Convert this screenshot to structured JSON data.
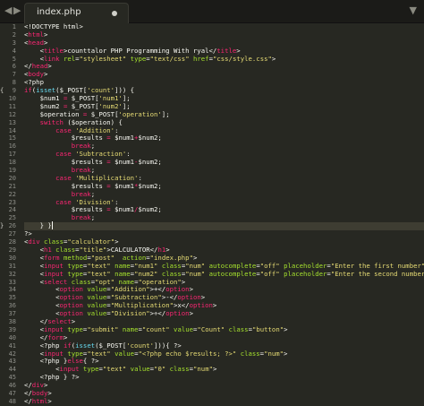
{
  "tab": {
    "filename": "index.php"
  },
  "icons": {
    "back": "chevron-left-icon",
    "forward": "chevron-right-icon",
    "menu": "chevron-down-icon"
  },
  "colors": {
    "background": "#272822",
    "keyword": "#f92672",
    "attribute": "#a6e22e",
    "string": "#e6db74",
    "plain": "#f8f8f2"
  },
  "lines": [
    {
      "n": "1",
      "tokens": [
        [
          "v",
          "<!DOCTYPE html>"
        ]
      ]
    },
    {
      "n": "2",
      "tokens": [
        [
          "v",
          "<"
        ],
        [
          "t",
          "html"
        ],
        [
          "v",
          ">"
        ]
      ]
    },
    {
      "n": "3",
      "tokens": [
        [
          "v",
          "<"
        ],
        [
          "t",
          "head"
        ],
        [
          "v",
          ">"
        ]
      ]
    },
    {
      "n": "4",
      "tokens": [
        [
          "v",
          "    <"
        ],
        [
          "t",
          "title"
        ],
        [
          "v",
          ">counttalor PHP Programming With ryal</"
        ],
        [
          "t",
          "title"
        ],
        [
          "v",
          ">"
        ]
      ]
    },
    {
      "n": "5",
      "tokens": [
        [
          "v",
          "    <"
        ],
        [
          "t",
          "link"
        ],
        [
          "v",
          " "
        ],
        [
          "a",
          "rel"
        ],
        [
          "v",
          "="
        ],
        [
          "s",
          "\"stylesheet\""
        ],
        [
          "v",
          " "
        ],
        [
          "a",
          "type"
        ],
        [
          "v",
          "="
        ],
        [
          "s",
          "\"text/css\""
        ],
        [
          "v",
          " "
        ],
        [
          "a",
          "href"
        ],
        [
          "v",
          "="
        ],
        [
          "s",
          "\"css/style.css\""
        ],
        [
          "v",
          ">"
        ]
      ]
    },
    {
      "n": "6",
      "tokens": [
        [
          "v",
          "</"
        ],
        [
          "t",
          "head"
        ],
        [
          "v",
          ">"
        ]
      ]
    },
    {
      "n": "7",
      "tokens": [
        [
          "v",
          "<"
        ],
        [
          "t",
          "body"
        ],
        [
          "v",
          ">"
        ]
      ]
    },
    {
      "n": "8",
      "tokens": [
        [
          "v",
          "<?php"
        ]
      ]
    },
    {
      "n": "9",
      "fold": "{",
      "tokens": [
        [
          "t",
          "if"
        ],
        [
          "v",
          "("
        ],
        [
          "f",
          "isset"
        ],
        [
          "v",
          "($_POST["
        ],
        [
          "s",
          "'count'"
        ],
        [
          "v",
          "])) {"
        ]
      ]
    },
    {
      "n": "10",
      "tokens": [
        [
          "v",
          "    $num1 "
        ],
        [
          "t",
          "="
        ],
        [
          "v",
          " $_POST["
        ],
        [
          "s",
          "'num1'"
        ],
        [
          "v",
          "];"
        ]
      ]
    },
    {
      "n": "11",
      "tokens": [
        [
          "v",
          "    $num2 "
        ],
        [
          "t",
          "="
        ],
        [
          "v",
          " $_POST["
        ],
        [
          "s",
          "'num2'"
        ],
        [
          "v",
          "];"
        ]
      ]
    },
    {
      "n": "12",
      "tokens": [
        [
          "v",
          "    $operation "
        ],
        [
          "t",
          "="
        ],
        [
          "v",
          " $_POST["
        ],
        [
          "s",
          "'operation'"
        ],
        [
          "v",
          "];"
        ]
      ]
    },
    {
      "n": "13",
      "tokens": [
        [
          "v",
          "    "
        ],
        [
          "t",
          "switch"
        ],
        [
          "v",
          " ($operation) {"
        ]
      ]
    },
    {
      "n": "14",
      "tokens": [
        [
          "v",
          "        "
        ],
        [
          "t",
          "case"
        ],
        [
          "v",
          " "
        ],
        [
          "s",
          "'Addition'"
        ],
        [
          "v",
          ":"
        ]
      ]
    },
    {
      "n": "15",
      "tokens": [
        [
          "v",
          "            $results "
        ],
        [
          "t",
          "="
        ],
        [
          "v",
          " $num1"
        ],
        [
          "t",
          "+"
        ],
        [
          "v",
          "$num2;"
        ]
      ]
    },
    {
      "n": "16",
      "tokens": [
        [
          "v",
          "            "
        ],
        [
          "t",
          "break"
        ],
        [
          "v",
          ";"
        ]
      ]
    },
    {
      "n": "17",
      "tokens": [
        [
          "v",
          "        "
        ],
        [
          "t",
          "case"
        ],
        [
          "v",
          " "
        ],
        [
          "s",
          "'Subtraction'"
        ],
        [
          "v",
          ":"
        ]
      ]
    },
    {
      "n": "18",
      "tokens": [
        [
          "v",
          "            $results "
        ],
        [
          "t",
          "="
        ],
        [
          "v",
          " $num1"
        ],
        [
          "t",
          "-"
        ],
        [
          "v",
          "$num2;"
        ]
      ]
    },
    {
      "n": "19",
      "tokens": [
        [
          "v",
          "            "
        ],
        [
          "t",
          "break"
        ],
        [
          "v",
          ";"
        ]
      ]
    },
    {
      "n": "20",
      "tokens": [
        [
          "v",
          "        "
        ],
        [
          "t",
          "case"
        ],
        [
          "v",
          " "
        ],
        [
          "s",
          "'Multiplication'"
        ],
        [
          "v",
          ":"
        ]
      ]
    },
    {
      "n": "21",
      "tokens": [
        [
          "v",
          "            $results "
        ],
        [
          "t",
          "="
        ],
        [
          "v",
          " $num1"
        ],
        [
          "t",
          "*"
        ],
        [
          "v",
          "$num2;"
        ]
      ]
    },
    {
      "n": "22",
      "tokens": [
        [
          "v",
          "            "
        ],
        [
          "t",
          "break"
        ],
        [
          "v",
          ";"
        ]
      ]
    },
    {
      "n": "23",
      "tokens": [
        [
          "v",
          "        "
        ],
        [
          "t",
          "case"
        ],
        [
          "v",
          " "
        ],
        [
          "s",
          "'Division'"
        ],
        [
          "v",
          ":"
        ]
      ]
    },
    {
      "n": "24",
      "tokens": [
        [
          "v",
          "            $results "
        ],
        [
          "t",
          "="
        ],
        [
          "v",
          " $num1"
        ],
        [
          "t",
          "/"
        ],
        [
          "v",
          "$num2;"
        ]
      ]
    },
    {
      "n": "25",
      "tokens": [
        [
          "v",
          "            "
        ],
        [
          "t",
          "break"
        ],
        [
          "v",
          ";"
        ]
      ]
    },
    {
      "n": "26",
      "fold": "}",
      "current": true,
      "tokens": [
        [
          "v",
          "    } }"
        ]
      ]
    },
    {
      "n": "27",
      "tokens": [
        [
          "v",
          "?>"
        ]
      ]
    },
    {
      "n": "28",
      "tokens": [
        [
          "v",
          "<"
        ],
        [
          "t",
          "div"
        ],
        [
          "v",
          " "
        ],
        [
          "a",
          "class"
        ],
        [
          "v",
          "="
        ],
        [
          "s",
          "\"calculator\""
        ],
        [
          "v",
          ">"
        ]
      ]
    },
    {
      "n": "29",
      "tokens": [
        [
          "v",
          "    <"
        ],
        [
          "t",
          "h1"
        ],
        [
          "v",
          " "
        ],
        [
          "a",
          "class"
        ],
        [
          "v",
          "="
        ],
        [
          "s",
          "\"title\""
        ],
        [
          "v",
          ">CALCULATOR</"
        ],
        [
          "t",
          "h1"
        ],
        [
          "v",
          ">"
        ]
      ]
    },
    {
      "n": "30",
      "tokens": [
        [
          "v",
          "    <"
        ],
        [
          "t",
          "form"
        ],
        [
          "v",
          " "
        ],
        [
          "a",
          "method"
        ],
        [
          "v",
          "="
        ],
        [
          "s",
          "\"post\""
        ],
        [
          "v",
          "  "
        ],
        [
          "a",
          "action"
        ],
        [
          "v",
          "="
        ],
        [
          "s",
          "\"index.php\""
        ],
        [
          "v",
          ">"
        ]
      ]
    },
    {
      "n": "31",
      "tokens": [
        [
          "v",
          "    <"
        ],
        [
          "t",
          "input"
        ],
        [
          "v",
          " "
        ],
        [
          "a",
          "type"
        ],
        [
          "v",
          "="
        ],
        [
          "s",
          "\"text\""
        ],
        [
          "v",
          " "
        ],
        [
          "a",
          "name"
        ],
        [
          "v",
          "="
        ],
        [
          "s",
          "\"num1\""
        ],
        [
          "v",
          " "
        ],
        [
          "a",
          "class"
        ],
        [
          "v",
          "="
        ],
        [
          "s",
          "\"num\""
        ],
        [
          "v",
          " "
        ],
        [
          "a",
          "autocomplete"
        ],
        [
          "v",
          "="
        ],
        [
          "s",
          "\"off\""
        ],
        [
          "v",
          " "
        ],
        [
          "a",
          "placeholder"
        ],
        [
          "v",
          "="
        ],
        [
          "s",
          "\"Enter the first number\""
        ],
        [
          "v",
          ">"
        ]
      ]
    },
    {
      "n": "32",
      "tokens": [
        [
          "v",
          "    <"
        ],
        [
          "t",
          "input"
        ],
        [
          "v",
          " "
        ],
        [
          "a",
          "type"
        ],
        [
          "v",
          "="
        ],
        [
          "s",
          "\"text\""
        ],
        [
          "v",
          " "
        ],
        [
          "a",
          "name"
        ],
        [
          "v",
          "="
        ],
        [
          "s",
          "\"num2\""
        ],
        [
          "v",
          " "
        ],
        [
          "a",
          "class"
        ],
        [
          "v",
          "="
        ],
        [
          "s",
          "\"num\""
        ],
        [
          "v",
          " "
        ],
        [
          "a",
          "autocomplete"
        ],
        [
          "v",
          "="
        ],
        [
          "s",
          "\"off\""
        ],
        [
          "v",
          " "
        ],
        [
          "a",
          "placeholder"
        ],
        [
          "v",
          "="
        ],
        [
          "s",
          "\"Enter the second number\""
        ],
        [
          "v",
          ">"
        ]
      ]
    },
    {
      "n": "33",
      "tokens": [
        [
          "v",
          "    <"
        ],
        [
          "t",
          "select"
        ],
        [
          "v",
          " "
        ],
        [
          "a",
          "class"
        ],
        [
          "v",
          "="
        ],
        [
          "s",
          "\"opt\""
        ],
        [
          "v",
          " "
        ],
        [
          "a",
          "name"
        ],
        [
          "v",
          "="
        ],
        [
          "s",
          "\"operation\""
        ],
        [
          "v",
          ">"
        ]
      ]
    },
    {
      "n": "34",
      "tokens": [
        [
          "v",
          "        <"
        ],
        [
          "t",
          "option"
        ],
        [
          "v",
          " "
        ],
        [
          "a",
          "value"
        ],
        [
          "v",
          "="
        ],
        [
          "s",
          "\"Addition\""
        ],
        [
          "v",
          ">+</"
        ],
        [
          "t",
          "option"
        ],
        [
          "v",
          ">"
        ]
      ]
    },
    {
      "n": "35",
      "tokens": [
        [
          "v",
          "        <"
        ],
        [
          "t",
          "option"
        ],
        [
          "v",
          " "
        ],
        [
          "a",
          "value"
        ],
        [
          "v",
          "="
        ],
        [
          "s",
          "\"Subtraction\""
        ],
        [
          "v",
          ">-</"
        ],
        [
          "t",
          "option"
        ],
        [
          "v",
          ">"
        ]
      ]
    },
    {
      "n": "36",
      "tokens": [
        [
          "v",
          "        <"
        ],
        [
          "t",
          "option"
        ],
        [
          "v",
          " "
        ],
        [
          "a",
          "value"
        ],
        [
          "v",
          "="
        ],
        [
          "s",
          "\"Multiplication\""
        ],
        [
          "v",
          ">x</"
        ],
        [
          "t",
          "option"
        ],
        [
          "v",
          ">"
        ]
      ]
    },
    {
      "n": "37",
      "tokens": [
        [
          "v",
          "        <"
        ],
        [
          "t",
          "option"
        ],
        [
          "v",
          " "
        ],
        [
          "a",
          "value"
        ],
        [
          "v",
          "="
        ],
        [
          "s",
          "\"Division\""
        ],
        [
          "v",
          ">÷</"
        ],
        [
          "t",
          "option"
        ],
        [
          "v",
          ">"
        ]
      ]
    },
    {
      "n": "38",
      "tokens": [
        [
          "v",
          "    </"
        ],
        [
          "t",
          "select"
        ],
        [
          "v",
          ">"
        ]
      ]
    },
    {
      "n": "39",
      "tokens": [
        [
          "v",
          "    <"
        ],
        [
          "t",
          "input"
        ],
        [
          "v",
          " "
        ],
        [
          "a",
          "type"
        ],
        [
          "v",
          "="
        ],
        [
          "s",
          "\"submit\""
        ],
        [
          "v",
          " "
        ],
        [
          "a",
          "name"
        ],
        [
          "v",
          "="
        ],
        [
          "s",
          "\"count\""
        ],
        [
          "v",
          " "
        ],
        [
          "a",
          "value"
        ],
        [
          "v",
          "="
        ],
        [
          "s",
          "\"Count\""
        ],
        [
          "v",
          " "
        ],
        [
          "a",
          "class"
        ],
        [
          "v",
          "="
        ],
        [
          "s",
          "\"button\""
        ],
        [
          "v",
          ">"
        ]
      ]
    },
    {
      "n": "40",
      "tokens": [
        [
          "v",
          "    </"
        ],
        [
          "t",
          "form"
        ],
        [
          "v",
          ">"
        ]
      ]
    },
    {
      "n": "41",
      "tokens": [
        [
          "v",
          "    <?php "
        ],
        [
          "t",
          "if"
        ],
        [
          "v",
          "("
        ],
        [
          "f",
          "isset"
        ],
        [
          "v",
          "($_POST["
        ],
        [
          "s",
          "'count'"
        ],
        [
          "v",
          "])){ ?>"
        ]
      ]
    },
    {
      "n": "42",
      "tokens": [
        [
          "v",
          "    <"
        ],
        [
          "t",
          "input"
        ],
        [
          "v",
          " "
        ],
        [
          "a",
          "type"
        ],
        [
          "v",
          "="
        ],
        [
          "s",
          "\"text\""
        ],
        [
          "v",
          " "
        ],
        [
          "a",
          "value"
        ],
        [
          "v",
          "="
        ],
        [
          "s",
          "\"<?php echo $results; ?>\""
        ],
        [
          "v",
          " "
        ],
        [
          "a",
          "class"
        ],
        [
          "v",
          "="
        ],
        [
          "s",
          "\"num\""
        ],
        [
          "v",
          ">"
        ]
      ]
    },
    {
      "n": "43",
      "tokens": [
        [
          "v",
          "    <?php }"
        ],
        [
          "t",
          "else"
        ],
        [
          "v",
          "{ ?>"
        ]
      ]
    },
    {
      "n": "44",
      "tokens": [
        [
          "v",
          "        <"
        ],
        [
          "t",
          "input"
        ],
        [
          "v",
          " "
        ],
        [
          "a",
          "type"
        ],
        [
          "v",
          "="
        ],
        [
          "s",
          "\"text\""
        ],
        [
          "v",
          " "
        ],
        [
          "a",
          "value"
        ],
        [
          "v",
          "="
        ],
        [
          "s",
          "\"0\""
        ],
        [
          "v",
          " "
        ],
        [
          "a",
          "class"
        ],
        [
          "v",
          "="
        ],
        [
          "s",
          "\"num\""
        ],
        [
          "v",
          ">"
        ]
      ]
    },
    {
      "n": "45",
      "tokens": [
        [
          "v",
          "    <?php } ?>"
        ]
      ]
    },
    {
      "n": "46",
      "tokens": [
        [
          "v",
          "</"
        ],
        [
          "t",
          "div"
        ],
        [
          "v",
          ">"
        ]
      ]
    },
    {
      "n": "47",
      "tokens": [
        [
          "v",
          "</"
        ],
        [
          "t",
          "body"
        ],
        [
          "v",
          ">"
        ]
      ]
    },
    {
      "n": "48",
      "tokens": [
        [
          "v",
          "</"
        ],
        [
          "t",
          "html"
        ],
        [
          "v",
          ">"
        ]
      ]
    }
  ]
}
